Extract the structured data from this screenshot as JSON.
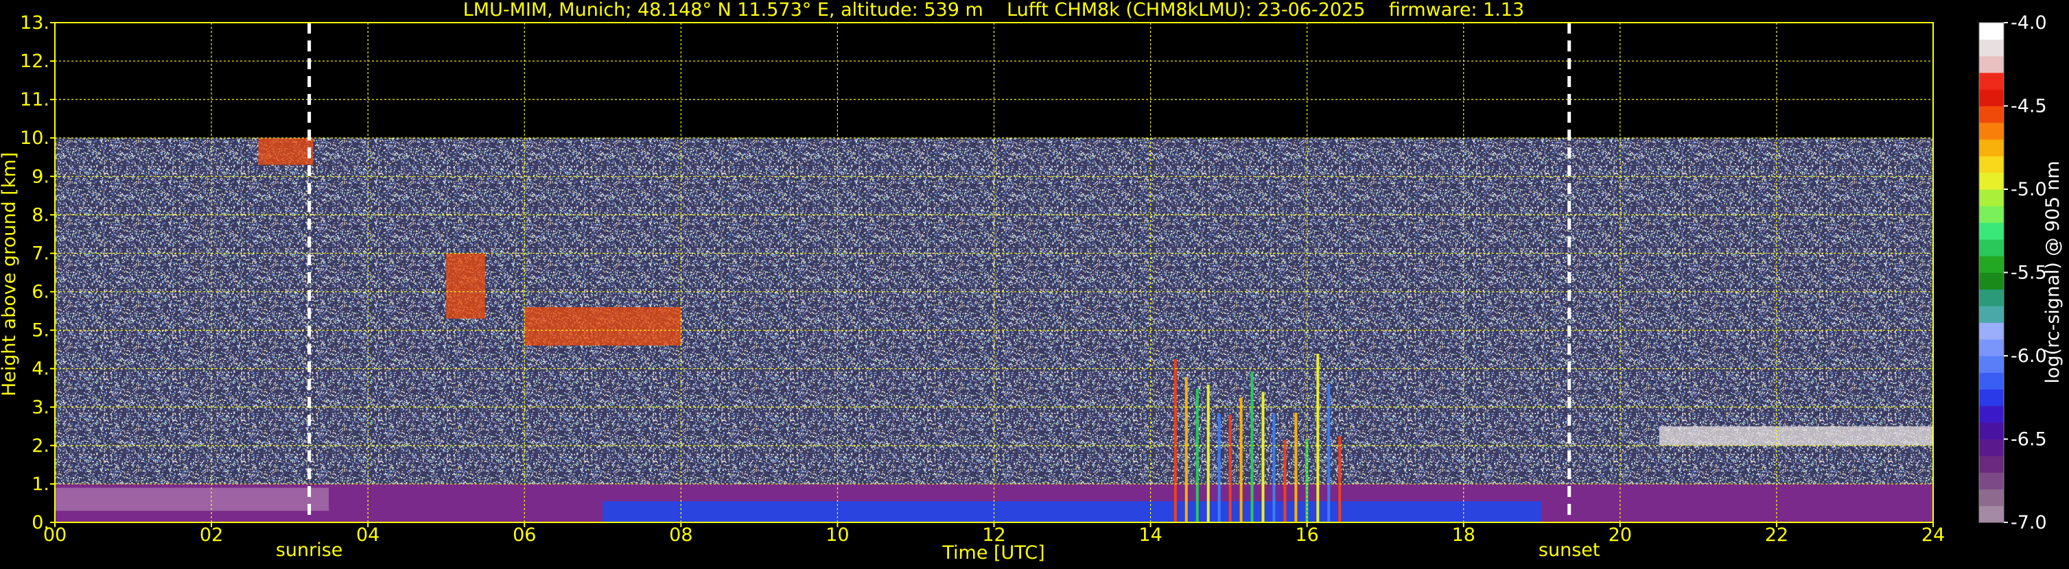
{
  "chart_data": {
    "type": "heatmap",
    "title": "LMU-MIM, Munich; 48.148° N 11.573° E, altitude: 539 m    Lufft CHM8k (CHM8kLMU): 23-06-2025    firmware: 1.13",
    "xlabel": "Time [UTC]",
    "ylabel": "Height above ground [km]",
    "xlim": [
      0,
      24
    ],
    "ylim": [
      0,
      13
    ],
    "x_ticks": [
      "00",
      "02",
      "04",
      "06",
      "08",
      "10",
      "12",
      "14",
      "16",
      "18",
      "20",
      "22",
      "24"
    ],
    "x_tick_values": [
      0,
      2,
      4,
      6,
      8,
      10,
      12,
      14,
      16,
      18,
      20,
      22,
      24
    ],
    "y_ticks": [
      "0.",
      "1.",
      "2.",
      "3.",
      "4.",
      "5.",
      "6.",
      "7.",
      "8.",
      "9.",
      "10.",
      "11.",
      "12.",
      "13."
    ],
    "y_tick_values": [
      0,
      1,
      2,
      3,
      4,
      5,
      6,
      7,
      8,
      9,
      10,
      11,
      12,
      13
    ],
    "grid": true,
    "max_range_km": 10,
    "events": [
      {
        "label": "sunrise",
        "time": 3.25
      },
      {
        "label": "sunset",
        "time": 19.35
      }
    ],
    "colorbar": {
      "label": "log(rc-signal) @ 905 nm",
      "range": [
        -7.0,
        -4.0
      ],
      "ticks": [
        "-4.0",
        "-4.5",
        "-5.0",
        "-5.5",
        "-6.0",
        "-6.5",
        "-7.0"
      ],
      "tick_values": [
        -4.0,
        -4.5,
        -5.0,
        -5.5,
        -6.0,
        -6.5,
        -7.0
      ],
      "colors": [
        "#a48aa4",
        "#8e6a8e",
        "#7d4a88",
        "#6c2a7e",
        "#5a1a8e",
        "#4a12a0",
        "#3a1ac8",
        "#2a3ae8",
        "#3a5ef4",
        "#5a7ef8",
        "#7a96fa",
        "#9aaefc",
        "#4aa8a8",
        "#2a9a7a",
        "#1a8a1a",
        "#22a822",
        "#2ac85a",
        "#3ae87a",
        "#7af05a",
        "#aaf03a",
        "#e8f02a",
        "#f8d81a",
        "#f8b00a",
        "#f8800a",
        "#f04a0a",
        "#e01a0a",
        "#f02a1a",
        "#e8c0c0",
        "#e8e0e0",
        "#ffffff"
      ]
    },
    "features": [
      {
        "kind": "boundary_layer",
        "x": [
          0,
          24
        ],
        "y_top_km": 1.0
      },
      {
        "kind": "aerosol_layer",
        "x": [
          20.5,
          24
        ],
        "y_km": [
          2.0,
          2.5
        ]
      },
      {
        "kind": "cloud",
        "x": [
          5.0,
          5.5
        ],
        "y_km": [
          5.3,
          7.0
        ]
      },
      {
        "kind": "cloud",
        "x": [
          6.0,
          8.0
        ],
        "y_km": [
          4.6,
          5.6
        ]
      },
      {
        "kind": "precipitation_streaks",
        "x": [
          14.3,
          16.4
        ],
        "y_km": [
          0,
          4.4
        ]
      },
      {
        "kind": "cloud",
        "x": [
          2.6,
          3.3
        ],
        "y_km": [
          9.3,
          10.0
        ]
      }
    ]
  }
}
